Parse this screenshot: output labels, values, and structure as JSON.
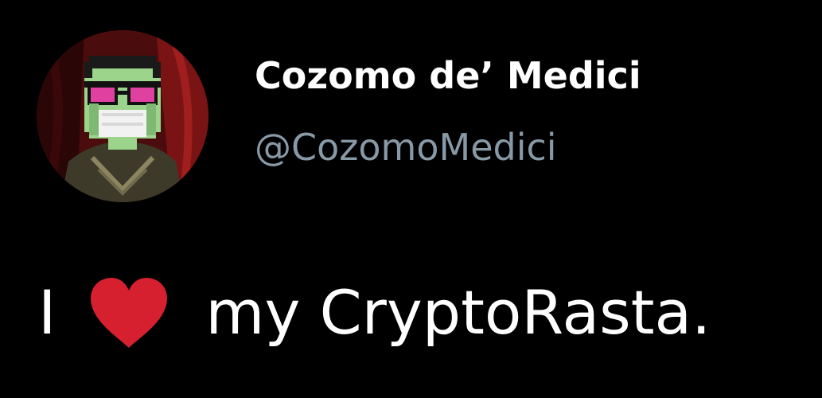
{
  "tweet": {
    "display_name": "Cozomo de’ Medici",
    "handle": "@CozomoMedici",
    "body": {
      "before": "I",
      "heart_icon": "heart-icon",
      "heart_color": "#d6202f",
      "after": "my CryptoRasta."
    }
  },
  "colors": {
    "background": "#000000",
    "name": "#ffffff",
    "handle": "#8899a6",
    "text": "#ffffff"
  }
}
